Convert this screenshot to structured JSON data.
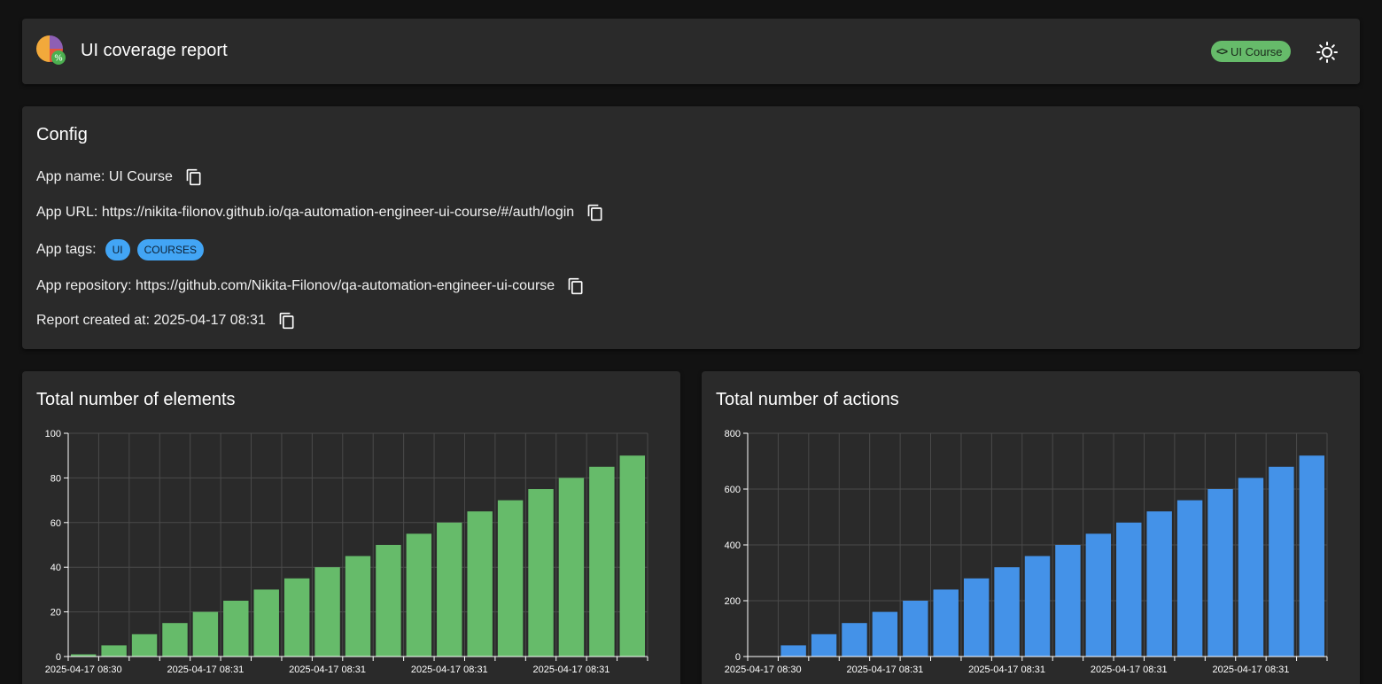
{
  "header": {
    "title": "UI coverage report",
    "chip_label": "UI Course",
    "chip_icon": "code-icon",
    "theme_icon": "sun-icon"
  },
  "config": {
    "heading": "Config",
    "app_name": "App name: UI Course",
    "app_url": "App URL: https://nikita-filonov.github.io/qa-automation-engineer-ui-course/#/auth/login",
    "app_tags_label": "App tags:",
    "app_tags": [
      "UI",
      "COURSES"
    ],
    "app_repository": "App repository: https://github.com/Nikita-Filonov/qa-automation-engineer-ui-course",
    "report_created_at": "Report created at: 2025-04-17 08:31"
  },
  "colors": {
    "elements_bar": "#66bb6a",
    "actions_bar": "#4492e8",
    "tag": "#42a5f5",
    "chip": "#66bb6a"
  },
  "charts": {
    "elements_title": "Total number of elements",
    "actions_title": "Total number of actions"
  },
  "chart_data": [
    {
      "type": "bar",
      "title": "Total number of elements",
      "x_tick_labels": [
        "2025-04-17 08:30",
        "2025-04-17 08:31",
        "2025-04-17 08:31",
        "2025-04-17 08:31",
        "2025-04-17 08:31"
      ],
      "values": [
        1,
        5,
        10,
        15,
        20,
        25,
        30,
        35,
        40,
        45,
        50,
        55,
        60,
        65,
        70,
        75,
        80,
        85,
        90
      ],
      "yticks": [
        0,
        20,
        40,
        60,
        80,
        100
      ],
      "ylim": [
        0,
        100
      ],
      "grid": true
    },
    {
      "type": "bar",
      "title": "Total number of actions",
      "x_tick_labels": [
        "2025-04-17 08:30",
        "2025-04-17 08:31",
        "2025-04-17 08:31",
        "2025-04-17 08:31",
        "2025-04-17 08:31"
      ],
      "values": [
        0,
        40,
        80,
        120,
        160,
        200,
        240,
        280,
        320,
        360,
        400,
        440,
        480,
        520,
        560,
        600,
        640,
        680,
        720
      ],
      "yticks": [
        0,
        200,
        400,
        600,
        800
      ],
      "ylim": [
        0,
        800
      ],
      "grid": true
    }
  ]
}
